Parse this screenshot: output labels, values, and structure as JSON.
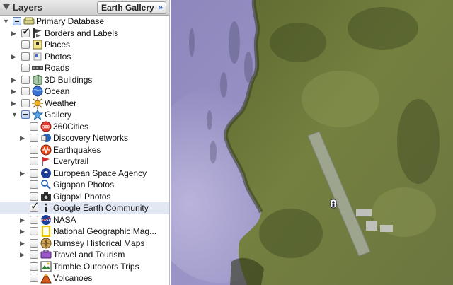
{
  "panel": {
    "title": "Layers",
    "gallery_button": "Earth Gallery",
    "gallery_chevron": "»"
  },
  "layers": [
    {
      "label": "Primary Database",
      "level": 0,
      "twisty": "open",
      "check": "mixed",
      "icon": "database-icon",
      "selected": false
    },
    {
      "label": "Borders and Labels",
      "level": 1,
      "twisty": "closed",
      "check": "checked",
      "icon": "borders-flag-icon",
      "selected": false
    },
    {
      "label": "Places",
      "level": 1,
      "twisty": "none",
      "check": "unchecked",
      "icon": "places-icon",
      "selected": false
    },
    {
      "label": "Photos",
      "level": 1,
      "twisty": "closed",
      "check": "unchecked",
      "icon": "photos-icon",
      "selected": false
    },
    {
      "label": "Roads",
      "level": 1,
      "twisty": "none",
      "check": "unchecked",
      "icon": "roads-icon",
      "selected": false
    },
    {
      "label": "3D Buildings",
      "level": 1,
      "twisty": "closed",
      "check": "unchecked",
      "icon": "buildings-3d-icon",
      "selected": false
    },
    {
      "label": "Ocean",
      "level": 1,
      "twisty": "closed",
      "check": "unchecked",
      "icon": "ocean-globe-icon",
      "selected": false
    },
    {
      "label": "Weather",
      "level": 1,
      "twisty": "closed",
      "check": "unchecked",
      "icon": "weather-sun-icon",
      "selected": false
    },
    {
      "label": "Gallery",
      "level": 1,
      "twisty": "open",
      "check": "mixed",
      "icon": "gallery-star-icon",
      "selected": false
    },
    {
      "label": "360Cities",
      "level": 2,
      "twisty": "none",
      "check": "unchecked",
      "icon": "360cities-icon",
      "selected": false
    },
    {
      "label": "Discovery Networks",
      "level": 2,
      "twisty": "closed",
      "check": "unchecked",
      "icon": "discovery-icon",
      "selected": false
    },
    {
      "label": "Earthquakes",
      "level": 2,
      "twisty": "none",
      "check": "unchecked",
      "icon": "earthquake-icon",
      "selected": false
    },
    {
      "label": "Everytrail",
      "level": 2,
      "twisty": "none",
      "check": "unchecked",
      "icon": "everytrail-icon",
      "selected": false
    },
    {
      "label": "European Space Agency",
      "level": 2,
      "twisty": "closed",
      "check": "unchecked",
      "icon": "esa-icon",
      "selected": false
    },
    {
      "label": "Gigapan Photos",
      "level": 2,
      "twisty": "none",
      "check": "unchecked",
      "icon": "gigapan-icon",
      "selected": false
    },
    {
      "label": "Gigapxl Photos",
      "level": 2,
      "twisty": "none",
      "check": "unchecked",
      "icon": "gigapxl-camera-icon",
      "selected": false
    },
    {
      "label": "Google Earth Community",
      "level": 2,
      "twisty": "none",
      "check": "checked",
      "icon": "info-icon",
      "selected": true
    },
    {
      "label": "NASA",
      "level": 2,
      "twisty": "closed",
      "check": "unchecked",
      "icon": "nasa-icon",
      "selected": false
    },
    {
      "label": "National Geographic Mag...",
      "level": 2,
      "twisty": "closed",
      "check": "unchecked",
      "icon": "natgeo-icon",
      "selected": false
    },
    {
      "label": "Rumsey Historical Maps",
      "level": 2,
      "twisty": "closed",
      "check": "unchecked",
      "icon": "rumsey-compass-icon",
      "selected": false
    },
    {
      "label": "Travel and Tourism",
      "level": 2,
      "twisty": "closed",
      "check": "unchecked",
      "icon": "travel-icon",
      "selected": false
    },
    {
      "label": "Trimble Outdoors Trips",
      "level": 2,
      "twisty": "none",
      "check": "unchecked",
      "icon": "trimble-icon",
      "selected": false
    },
    {
      "label": "Volcanoes",
      "level": 2,
      "twisty": "none",
      "check": "unchecked",
      "icon": "volcano-icon",
      "selected": false
    }
  ],
  "colors": {
    "selected_row": "#e2e8f3",
    "panel_border": "#bdbdbd",
    "map_water": "#8f89bf",
    "map_land": "#6f7a3c"
  }
}
